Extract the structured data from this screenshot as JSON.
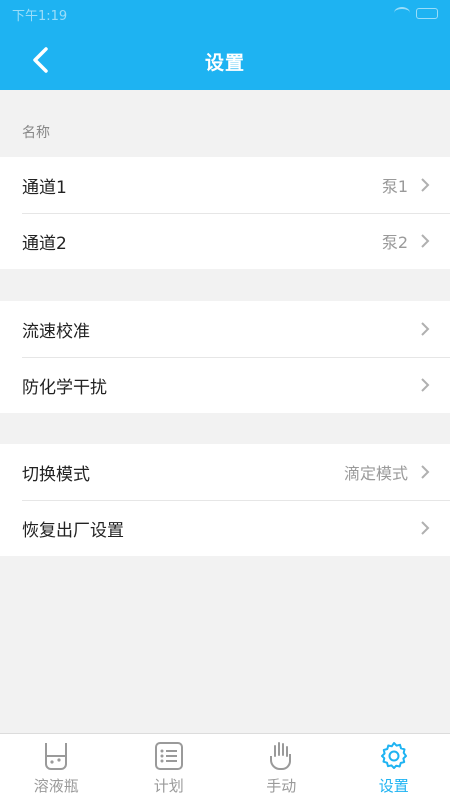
{
  "status_bar": {
    "time": "下午1:19"
  },
  "header": {
    "title": "设置"
  },
  "groups": {
    "name_header": "名称",
    "channels": [
      {
        "label": "通道1",
        "value": "泵1"
      },
      {
        "label": "通道2",
        "value": "泵2"
      }
    ],
    "calibration": [
      {
        "label": "流速校准"
      },
      {
        "label": "防化学干扰"
      }
    ],
    "modes": [
      {
        "label": "切换模式",
        "value": "滴定模式"
      },
      {
        "label": "恢复出厂设置"
      }
    ]
  },
  "tabs": [
    {
      "label": "溶液瓶",
      "icon": "flask-icon",
      "active": false
    },
    {
      "label": "计划",
      "icon": "list-icon",
      "active": false
    },
    {
      "label": "手动",
      "icon": "hand-icon",
      "active": false
    },
    {
      "label": "设置",
      "icon": "gear-icon",
      "active": true
    }
  ],
  "colors": {
    "accent": "#1eb3f2",
    "inactive": "#9a9a9a"
  }
}
